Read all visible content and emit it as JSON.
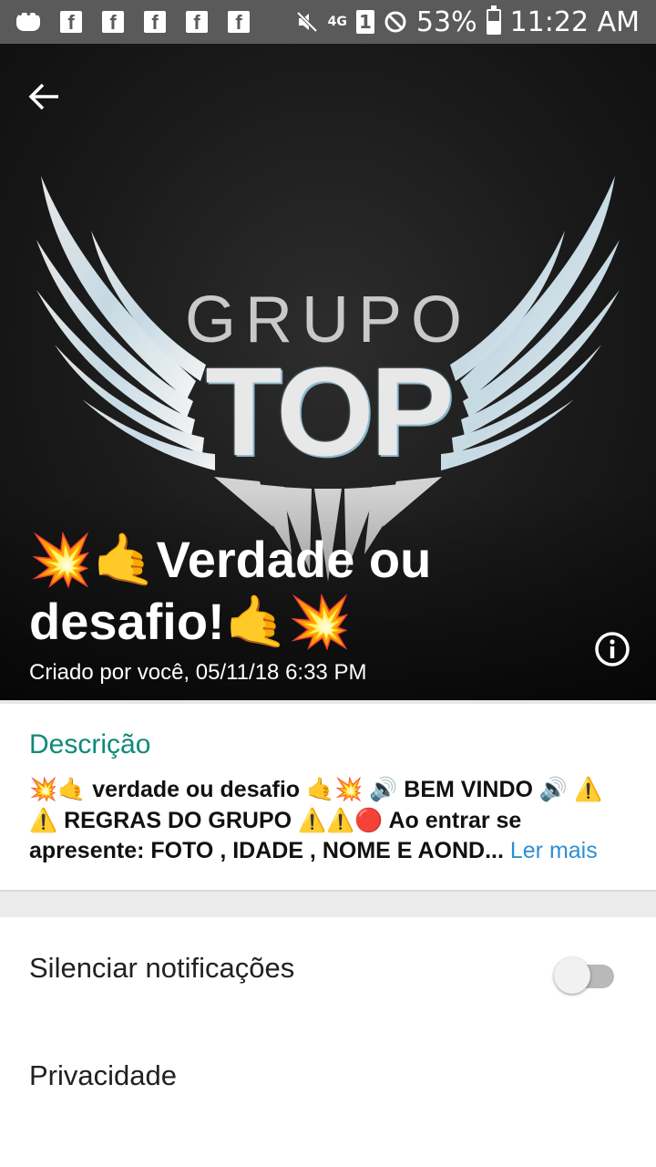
{
  "status_bar": {
    "battery": "53%",
    "time": "11:22 AM",
    "network": "4G",
    "sim": "1",
    "notification_icons": [
      "messenger-icon",
      "facebook-icon",
      "facebook-icon",
      "facebook-icon",
      "facebook-icon",
      "facebook-icon"
    ]
  },
  "header": {
    "logo_top_word": "GRUPO",
    "logo_main_word": "TOP",
    "group_name": "💥🤙Verdade ou desafio!🤙💥",
    "created_text": "Criado por você, 05/11/18 6:33 PM"
  },
  "description": {
    "label": "Descrição",
    "line1": "💥🤙 verdade ou desafio 🤙💥 🔊 BEM VINDO 🔊 ⚠️",
    "line2": "⚠️ REGRAS DO GRUPO ⚠️⚠️🔴 Ao entrar se",
    "line3": "apresente: FOTO , IDADE , NOME E AOND...",
    "read_more": "Ler mais"
  },
  "settings": {
    "mute_label": "Silenciar notificações",
    "mute_enabled": false,
    "privacy_label": "Privacidade"
  },
  "colors": {
    "status_bar": "#5a5a5a",
    "accent_green": "#0e8a78",
    "link_blue": "#2e8fd4"
  }
}
